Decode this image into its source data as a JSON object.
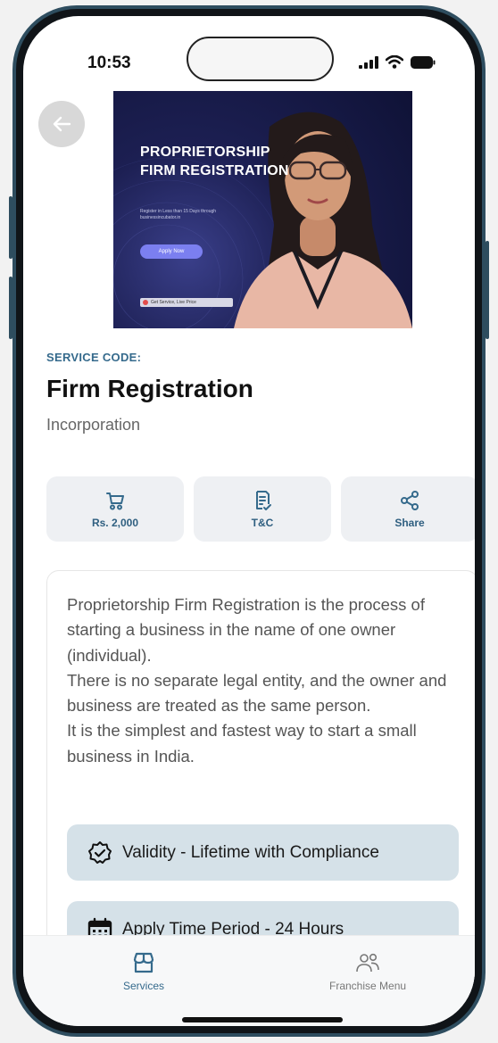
{
  "status_bar": {
    "time": "10:53"
  },
  "hero": {
    "title": "PROPRIETORSHIP FIRM REGISTRATION",
    "subtitle": "Register in Less than 15 Days through businessincubator.in",
    "apply_label": "Apply Now",
    "badge": "Get Service, Live Price"
  },
  "service": {
    "code_label": "SERVICE CODE:",
    "title": "Firm Registration",
    "category": "Incorporation"
  },
  "actions": [
    {
      "label": "Rs. 2,000",
      "icon": "cart-icon"
    },
    {
      "label": "T&C",
      "icon": "document-icon"
    },
    {
      "label": "Share",
      "icon": "share-icon"
    }
  ],
  "description": {
    "paragraphs": [
      "Proprietorship Firm Registration is the process of starting a business in the name of one owner (individual).",
      "There is no separate legal entity, and the owner and business are treated as the same person.",
      "It is the simplest and fastest way to start a small business in India."
    ]
  },
  "features": [
    {
      "label": "Validity - Lifetime with Compliance",
      "icon": "badge-check-icon"
    },
    {
      "label": "Apply Time Period - 24 Hours",
      "icon": "calendar-icon"
    }
  ],
  "bottom_nav": {
    "items": [
      {
        "label": "Services",
        "icon": "store-icon",
        "active": true
      },
      {
        "label": "Franchise Menu",
        "icon": "users-icon",
        "active": false
      }
    ]
  },
  "colors": {
    "accent": "#356a8c",
    "feature_bg": "#d5e1e8",
    "action_bg": "#eef0f3",
    "frame": "#2e4d5f"
  }
}
